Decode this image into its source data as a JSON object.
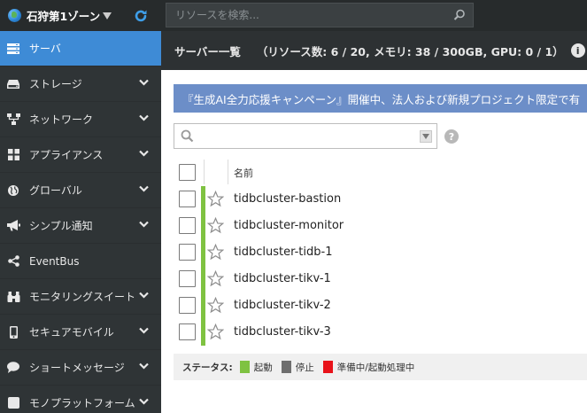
{
  "topbar": {
    "zone_label": "石狩第1ゾーン",
    "search_placeholder": "リソースを検索..."
  },
  "sidebar": {
    "items": [
      {
        "label": "サーバ",
        "icon": "server-icon",
        "active": true
      },
      {
        "label": "ストレージ",
        "icon": "storage-icon"
      },
      {
        "label": "ネットワーク",
        "icon": "network-icon"
      },
      {
        "label": "アプライアンス",
        "icon": "appliance-icon"
      },
      {
        "label": "グローバル",
        "icon": "globe-icon"
      },
      {
        "label": "シンプル通知",
        "icon": "megaphone-icon"
      },
      {
        "label": "EventBus",
        "icon": "share-icon"
      },
      {
        "label": "モニタリングスイート",
        "icon": "binoculars-icon"
      },
      {
        "label": "セキュアモバイル",
        "icon": "mobile-icon"
      },
      {
        "label": "ショートメッセージ",
        "icon": "chat-bubble-icon"
      },
      {
        "label": "モノプラットフォーム",
        "icon": "platform-icon"
      }
    ]
  },
  "header": {
    "title": "サーバー一覧",
    "resources": "（リソース数: 6 / 20, メモリ: 38 / 300GB, GPU: 0 / 1）"
  },
  "banner": {
    "text": "『生成AI全力応援キャンペーン』開催中、法人および新規プロジェクト限定で有"
  },
  "filter": {
    "value": ""
  },
  "table": {
    "column_name": "名前",
    "rows": [
      {
        "name": "tidbcluster-bastion",
        "status": "running"
      },
      {
        "name": "tidbcluster-monitor",
        "status": "running"
      },
      {
        "name": "tidbcluster-tidb-1",
        "status": "running"
      },
      {
        "name": "tidbcluster-tikv-1",
        "status": "running"
      },
      {
        "name": "tidbcluster-tikv-2",
        "status": "running"
      },
      {
        "name": "tidbcluster-tikv-3",
        "status": "running"
      }
    ]
  },
  "legend": {
    "title": "ステータス:",
    "items": [
      {
        "label": "起動",
        "color": "#7fc241"
      },
      {
        "label": "停止",
        "color": "#6e6e6e"
      },
      {
        "label": "準備中/起動処理中",
        "color": "#e8131a"
      }
    ]
  },
  "colors": {
    "accent": "#3e8bd6",
    "banner": "#6c8ec8",
    "sidebar_bg": "#2f3436",
    "topbar_bg": "#272b2c"
  }
}
